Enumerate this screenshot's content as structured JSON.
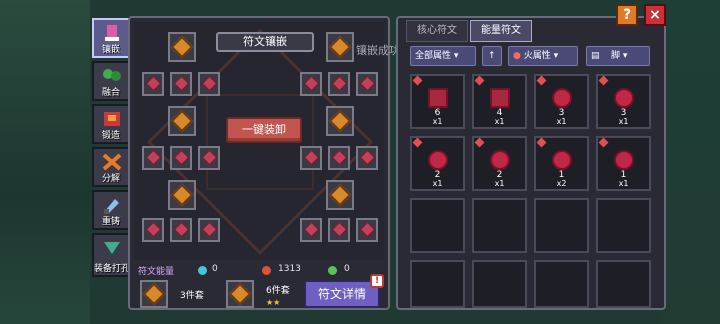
{
  "side_tabs": [
    {
      "label": "镶嵌",
      "active": true
    },
    {
      "label": "融合",
      "active": false
    },
    {
      "label": "锻造",
      "active": false
    },
    {
      "label": "分解",
      "active": false
    },
    {
      "label": "重铸",
      "active": false
    },
    {
      "label": "装备打孔",
      "active": false
    }
  ],
  "rune_board": {
    "title": "符文镶嵌",
    "one_key_button": "一键装卸"
  },
  "energy": {
    "label": "符文能量",
    "values": [
      "0",
      "1313",
      "0"
    ],
    "colors": [
      "#3fc9d9",
      "#e0503a",
      "#58c45a"
    ]
  },
  "sets": [
    {
      "label": "3件套",
      "stars": ""
    },
    {
      "label": "6件套",
      "stars": "★★"
    }
  ],
  "detail_button": "符文详情",
  "detail_badge": "!",
  "toast": "镶嵌成功",
  "right_tabs": [
    "核心符文",
    "能量符文"
  ],
  "filters": {
    "attr_all": "全部属性",
    "sort_icon": "arrow-up-icon",
    "fire_attr": "火属性",
    "slot": "脚"
  },
  "inventory": [
    {
      "level": "6",
      "count": "x1",
      "shape": "square"
    },
    {
      "level": "4",
      "count": "x1",
      "shape": "square"
    },
    {
      "level": "3",
      "count": "x1",
      "shape": "round"
    },
    {
      "level": "3",
      "count": "x1",
      "shape": "round"
    },
    {
      "level": "2",
      "count": "x1",
      "shape": "round"
    },
    {
      "level": "2",
      "count": "x1",
      "shape": "round"
    },
    {
      "level": "1",
      "count": "x2",
      "shape": "round"
    },
    {
      "level": "1",
      "count": "x1",
      "shape": "round"
    }
  ],
  "help_label": "?",
  "close_label": "×"
}
